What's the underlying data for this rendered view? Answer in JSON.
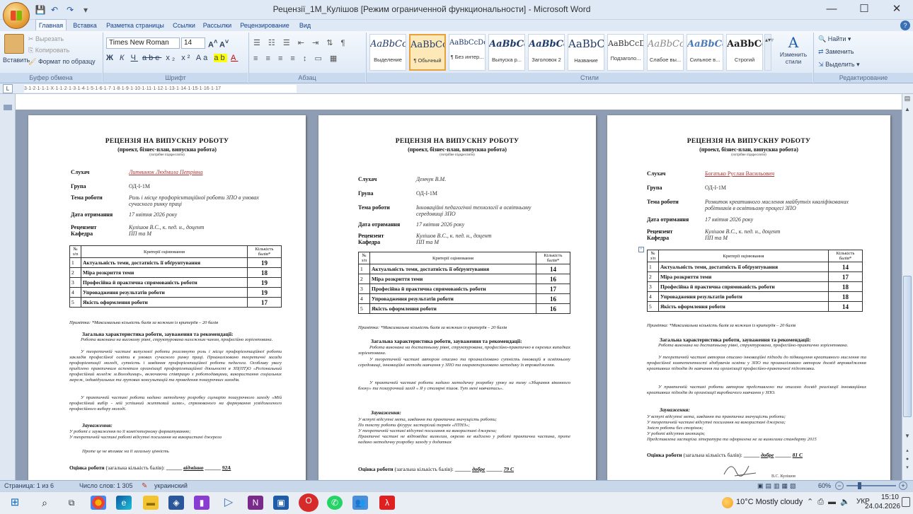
{
  "window": {
    "title": "Рецензії_1М_Кулішов [Режим ограниченной функциональности] - Microsoft Word",
    "minimize": "—",
    "maximize": "☐",
    "close": "✕"
  },
  "tabs": [
    "Главная",
    "Вставка",
    "Разметка страницы",
    "Ссылки",
    "Рассылки",
    "Рецензирование",
    "Вид"
  ],
  "ribbon": {
    "clipboard": {
      "paste": "Вставить",
      "cut": "Вырезать",
      "copy": "Копировать",
      "format_painter": "Формат по образцу",
      "label": "Буфер обмена"
    },
    "font": {
      "name": "Times New Roman",
      "size": "14",
      "label": "Шрифт"
    },
    "paragraph": {
      "label": "Абзац"
    },
    "styles": {
      "items": [
        {
          "preview": "AaBbCcI",
          "caption": "Выделение"
        },
        {
          "preview": "AaBbCc",
          "caption": "¶ Обычный",
          "selected": true
        },
        {
          "preview": "AaBbCcDd",
          "caption": "¶ Без интер..."
        },
        {
          "preview": "AaBbCc",
          "caption": "Выпуска р..."
        },
        {
          "preview": "AaBbCc",
          "caption": "Заголовок 2"
        },
        {
          "preview": "AaBbC",
          "caption": "Название"
        },
        {
          "preview": "AaBbCcD",
          "caption": "Подзаголо..."
        },
        {
          "preview": "AaBbCcI",
          "caption": "Слабое вы..."
        },
        {
          "preview": "AaBbCcI",
          "caption": "Сильное в..."
        },
        {
          "preview": "AaBbCcI",
          "caption": "Строгий"
        }
      ],
      "change": "Изменить стили",
      "label": "Стили"
    },
    "editing": {
      "find": "Найти",
      "replace": "Заменить",
      "select": "Выделить",
      "label": "Редактирование"
    }
  },
  "ruler": "3·1·2·1·1·1·X·1·1·2·1·3·1·4·1·5·1·6·1·7·1·8·1·9·1·10·1·11·1·12·1·13·1·14·1·15·1·16·1·17",
  "pages": [
    {
      "title": "РЕЦЕНЗІЯ НА ВИПУСКНУ РОБОТУ",
      "subtitle": "(проект, бізнес-план, випускна робота)",
      "hint": "(потрібне підкреслити)",
      "student_label": "Слухач",
      "student": "Литвинюк Людмила Петрівна",
      "group_label": "Група",
      "group": "ОД-І-1М",
      "topic_label": "Тема роботи",
      "topic": "Роль і місце профорієнтаційної роботи ЗПО в умовах сучасного ринку праці",
      "date_label": "Дата отримання",
      "date": "17 квітня 2026 року",
      "reviewer_label": "Рецензент",
      "reviewer": "Кулішов В.С., к. пед. н., доцент",
      "dept_label": "Кафедра",
      "dept": "ПП та М",
      "criteria": [
        {
          "n": "1",
          "c": "Актуальність теми, достатність її обґрунтування",
          "s": "19"
        },
        {
          "n": "2",
          "c": "Міра розкриття теми",
          "s": "18"
        },
        {
          "n": "3",
          "c": "Професійна й практична спрямованість роботи",
          "s": "19"
        },
        {
          "n": "4",
          "c": "Упровадження результатів роботи",
          "s": "19"
        },
        {
          "n": "5",
          "c": "Якість оформлення роботи",
          "s": "17"
        }
      ],
      "general_title": "Загальна характеристика роботи, зауваження та рекомендації:",
      "general": [
        "Робота виконана на високому рівні, структурована належним чином, професійно зорієнтована.",
        "У теоретичній частині випускної роботи розглянуто роль і місце профорієнтаційної роботи закладів професійної освіти в умовах сучасного ринку праці. Проаналізовано теоретичні засади профорієнтації молоді, сутність і завдання профорієнтаційної роботи педагога. Особливу увагу приділено практичним аспектам організації профорієнтаційної діяльності в ЗП(ПТ)О «Регіональний професійний коледж м.Володимир», включаючи співпрацю з роботодавцями, використання соціальних мереж, індивідуальних та групових консультацій та проведення позаурочних заходів.",
        "У практичній частині роботи надано методичну розробку сценарію позаурочного заходу «Мій професійний вибір - мій успішний життєвий шлях», спрямованого на формування усвідомленого професійного вибору молоді."
      ],
      "remarks_title": "Зауваження:",
      "remarks": [
        "У роботі є зауваження по її комп'ютерному форматуванню;",
        "У теоретичній частині роботі відсутні посилання на використані джерела"
      ],
      "closing": "Проте це не впливає на її загальну цінність",
      "score_label": "Оцінка роботи",
      "score_hint": "(загальна кількість балів):",
      "grade": "відмінно",
      "points": "92А"
    },
    {
      "title": "РЕЦЕНЗІЯ НА ВИПУСКНУ РОБОТУ",
      "subtitle": "(проект, бізнес-план, випускна робота)",
      "hint": "(потрібне підкреслити)",
      "student_label": "Слухач",
      "student": "Демчук В.М.",
      "group_label": "Група",
      "group": "ОД-І-1М",
      "topic_label": "Тема роботи",
      "topic": "Інноваційні педагогічні технології в освітньому середовищі ЗПО",
      "date_label": "Дата отримання",
      "date": "17 квітня 2026 року",
      "reviewer_label": "Рецензент",
      "reviewer": "Кулішов В.С., к. пед. н., доцент",
      "dept_label": "Кафедра",
      "dept": "ПП та М",
      "criteria": [
        {
          "n": "1",
          "c": "Актуальність теми, достатність її обґрунтування",
          "s": "14"
        },
        {
          "n": "2",
          "c": "Міра розкриття теми",
          "s": "16"
        },
        {
          "n": "3",
          "c": "Професійна й практична спрямованість роботи",
          "s": "17"
        },
        {
          "n": "4",
          "c": "Упровадження результатів роботи",
          "s": "16"
        },
        {
          "n": "5",
          "c": "Якість оформлення роботи",
          "s": "16"
        }
      ],
      "general_title": "Загальна характеристика роботи, зауваження та рекомендації:",
      "general": [
        "Робота виконана на достатньому рівні, структурована, професійно-практично в окремих випадках зорієнтована.",
        "У теоретичній частині автором описано та проаналізовано сутність інновацій в освітньому середовищі, інноваційні методи навчання у ЗПО та охарактеризовано методику їх впровадження.",
        "У практичній частині роботи надано методичну розробку уроку на тему «Збирання віконного блоку» та позаурочний захід « Я у столярні пішов. Тут мені навчатись»."
      ],
      "remarks_title": "Зауваження:",
      "remarks": [
        "У вступі відсутні мета, завдання та практична значущість роботи;",
        "По тексту роботи фігурує застарілий термін «ПТНЗ»;",
        "У теоретичній частині відсутні посилання на використані джерела;",
        "Практичні частині не відповідає вимогам, окремо не виділено у роботі практична частина, проте надано методичну розробку заходу у додатках"
      ],
      "closing": "",
      "score_label": "Оцінка роботи",
      "score_hint": "(загальна кількість балів):",
      "grade": "добре",
      "points": "79 С"
    },
    {
      "title": "РЕЦЕНЗІЯ НА ВИПУСКНУ РОБОТУ",
      "subtitle": "(проект, бізнес-план, випускна робота)",
      "hint": "(потрібне підкреслити)",
      "student_label": "Слухач",
      "student": "Богатько Руслан Васильович",
      "group_label": "Група",
      "group": "ОД-І-1М",
      "topic_label": "Тема роботи",
      "topic": "Розвиток креативного мислення майбутніх кваліфікованих робітників в освітньому процесі ЗПО",
      "date_label": "Дата отримання",
      "date": "17 квітня 2026 року",
      "reviewer_label": "Рецензент",
      "reviewer": "Кулішов В.С., к. пед. н., доцент",
      "dept_label": "Кафедра",
      "dept": "ПП та М",
      "criteria": [
        {
          "n": "1",
          "c": "Актуальність теми, достатність її обґрунтування",
          "s": "14"
        },
        {
          "n": "2",
          "c": "Міра розкриття теми",
          "s": "17"
        },
        {
          "n": "3",
          "c": "Професійна й практична спрямованість роботи",
          "s": "18"
        },
        {
          "n": "4",
          "c": "Упровадження результатів роботи",
          "s": "18"
        },
        {
          "n": "5",
          "c": "Якість оформлення роботи",
          "s": "14"
        }
      ],
      "general_title": "Загальна характеристика роботи, зауваження та рекомендації:",
      "general": [
        "Робота виконана на достатньому рівні, структурована, професійно-практично зорієнтована.",
        "У теоретичній частині автором описано інноваційні підходи до підвищення креативного мислення та професійної компетентності здобувачів освіти у ЗПО та проаналізовано автором досвід впровадження креативних підходів до навчання та організації професійно-практичної підготовки.",
        "У практичній частині роботи автором представлено та описано досвід реалізації інноваційних креативних підходів до організації виробничого навчання у ЗПО."
      ],
      "remarks_title": "Зауваження:",
      "remarks": [
        "У вступі відсутні мета, завдання та практична значущість роботи;",
        "У теоретичній частині відсутні посилання на використані джерела;",
        "Зміст роботи без сторінок;",
        "У роботі відсутня анотація;",
        "Представлена застаріла література та оформлена не за вимогами стандарту 2015"
      ],
      "closing": "",
      "score_label": "Оцінка роботи",
      "score_hint": "(загальна кількість балів):",
      "grade": "добре",
      "points": "81 С"
    }
  ],
  "table_head": {
    "num": "№ з/п",
    "crit": "Критерії оцінювання",
    "score": "Кількість балів*"
  },
  "table_note": "Примітка: *Максимальна кількість балів за кожним із критеріїв – 20 балів",
  "signature": "В.С. Кулішов",
  "status": {
    "page": "Страница: 1 из 6",
    "words": "Число слов: 1 305",
    "lang": "украинский",
    "zoom": "60%"
  },
  "taskbar": {
    "weather": "10°C  Mostly cloudy",
    "lang": "УКР",
    "time": "15:10",
    "date": "24.04.2026"
  }
}
